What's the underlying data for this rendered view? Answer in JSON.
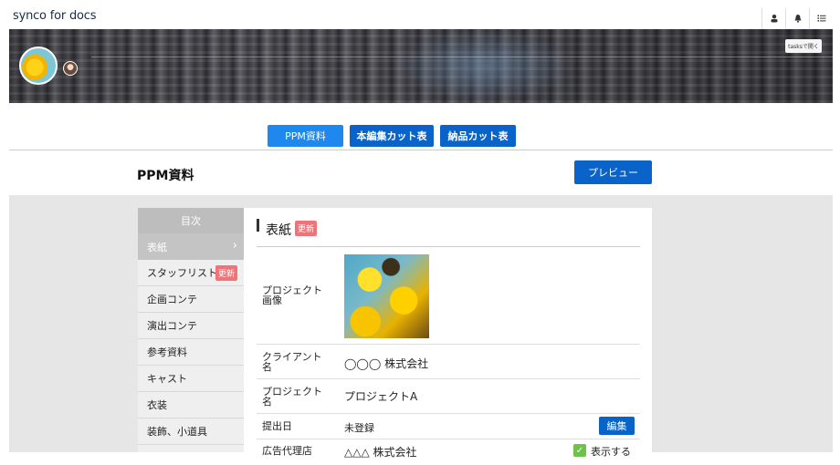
{
  "app": {
    "logo": "synco for docs"
  },
  "cover": {
    "button_label": "tasksで開く"
  },
  "tabs": [
    {
      "label": "PPM資料",
      "active": true
    },
    {
      "label": "本編集カット表",
      "active": false
    },
    {
      "label": "納品カット表",
      "active": false
    }
  ],
  "page": {
    "title": "PPM資料",
    "preview_label": "プレビュー"
  },
  "sidebar": {
    "heading": "目次",
    "items": [
      {
        "label": "表紙",
        "active": true
      },
      {
        "label": "スタッフリスト",
        "badge": "更新"
      },
      {
        "label": "企画コンテ"
      },
      {
        "label": "演出コンテ"
      },
      {
        "label": "参考資料"
      },
      {
        "label": "キャスト"
      },
      {
        "label": "衣装"
      },
      {
        "label": "装飾、小道具"
      }
    ]
  },
  "section": {
    "title": "表紙",
    "badge": "更新",
    "rows": {
      "image_label": "プロジェクト画像",
      "client_label": "クライアント名",
      "client_value": "◯◯◯ 株式会社",
      "project_label": "プロジェクト名",
      "project_value": "プロジェクトA",
      "submit_label": "提出日",
      "submit_value": "未登録",
      "edit_label": "編集",
      "agency_label": "広告代理店",
      "agency_value": "△△△ 株式会社",
      "display_label": "表示する"
    }
  },
  "colors": {
    "primary": "#0a63c9",
    "active_tab": "#1e88ee",
    "badge": "#f2727a"
  }
}
